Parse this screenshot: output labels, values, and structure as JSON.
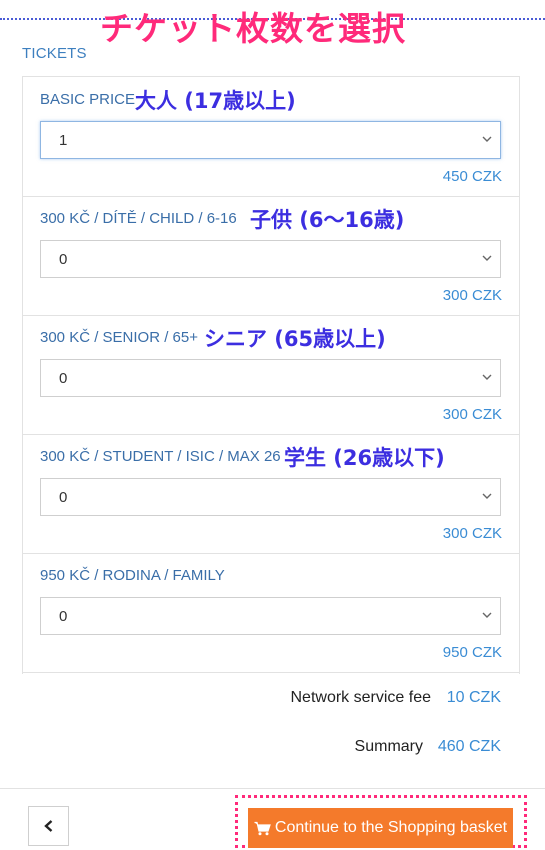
{
  "annotation": {
    "title": "チケット枚数を選択"
  },
  "tickets": {
    "title": "TICKETS",
    "rows": [
      {
        "label": "BASIC PRICE",
        "callout": "大人 (17歳以上)",
        "quantity": "1",
        "price": "450 CZK"
      },
      {
        "label": "300 KČ / DÍTĚ / CHILD / 6-16",
        "callout": "子供 (6〜16歳)",
        "quantity": "0",
        "price": "300 CZK"
      },
      {
        "label": "300 KČ / SENIOR / 65+",
        "callout": "シニア (65歳以上)",
        "quantity": "0",
        "price": "300 CZK"
      },
      {
        "label": "300 KČ / STUDENT / ISIC / MAX 26",
        "callout": "学生 (26歳以下)",
        "quantity": "0",
        "price": "300 CZK"
      },
      {
        "label": "950 KČ / RODINA / FAMILY",
        "callout": "",
        "quantity": "0",
        "price": "950 CZK"
      }
    ]
  },
  "summary": {
    "fee_label": "Network service fee",
    "fee_value": "10 CZK",
    "total_label": "Summary",
    "total_value": "460 CZK"
  },
  "footer": {
    "back_icon": "chevron-left-icon",
    "continue_icon": "cart-icon",
    "continue_label": "Continue to the Shopping basket"
  },
  "colors": {
    "annotation_title": "#ff2a7a",
    "annotation_callout": "#3c2ee0",
    "label_blue": "#3a6ea8",
    "price_blue": "#3a8cd4",
    "cta_orange": "#f47a2b"
  }
}
